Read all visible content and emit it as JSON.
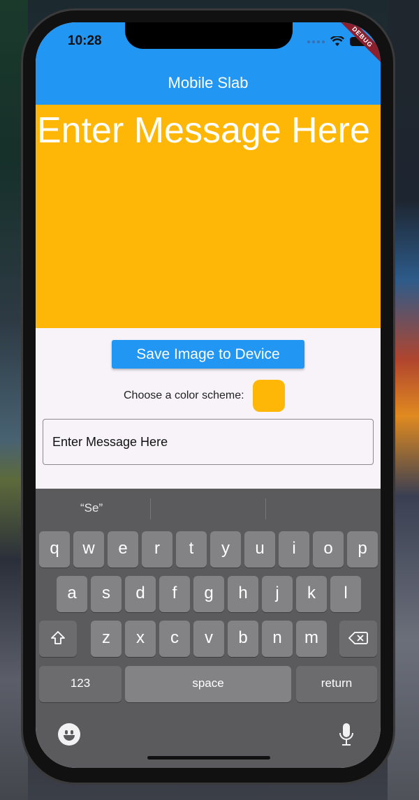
{
  "status_bar": {
    "time": "10:28",
    "debug_label": "DEBUG"
  },
  "app_bar": {
    "title": "Mobile Slab"
  },
  "slab": {
    "message": "Enter Message Here",
    "background_color": "#ffb707"
  },
  "actions": {
    "save_label": "Save Image to Device"
  },
  "color_scheme": {
    "label": "Choose a color scheme:",
    "selected_color": "#ffb707"
  },
  "message_field": {
    "value": "Enter Message Here"
  },
  "keyboard": {
    "suggestions": [
      "“Se”",
      "",
      ""
    ],
    "row1": [
      "q",
      "w",
      "e",
      "r",
      "t",
      "y",
      "u",
      "i",
      "o",
      "p"
    ],
    "row2": [
      "a",
      "s",
      "d",
      "f",
      "g",
      "h",
      "j",
      "k",
      "l"
    ],
    "row3": [
      "z",
      "x",
      "c",
      "v",
      "b",
      "n",
      "m"
    ],
    "numbers_label": "123",
    "space_label": "space",
    "return_label": "return"
  },
  "colors": {
    "accent": "#2196f3",
    "keyboard_bg": "#5b5b5e",
    "key": "#838386"
  }
}
